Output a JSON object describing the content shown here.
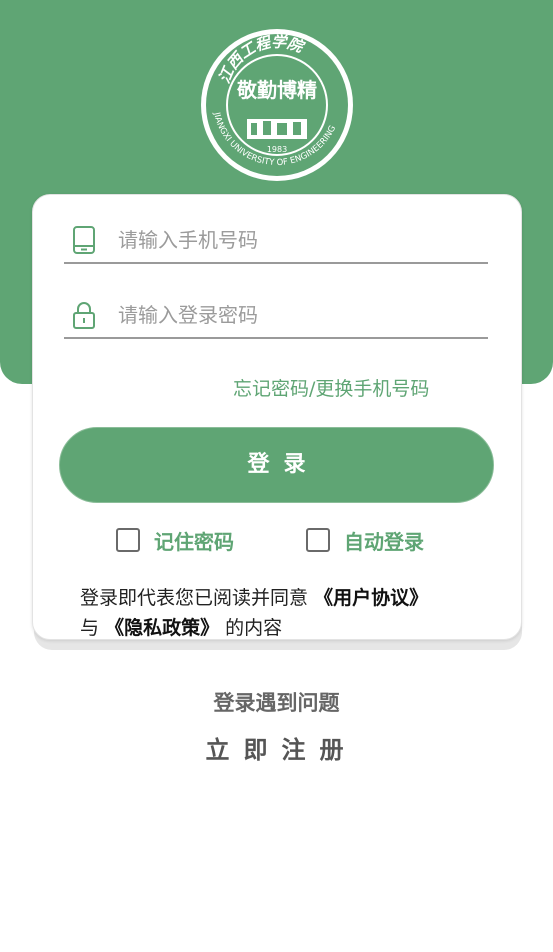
{
  "logo": {
    "icon": "university-seal-icon",
    "arc_top_text": "江西工程学院",
    "arc_bottom_text": "JIANGXI UNIVERSITY OF ENGINEERING",
    "motto": "敬勤博精",
    "year": "1983"
  },
  "form": {
    "phone": {
      "placeholder": "请输入手机号码",
      "value": "",
      "icon": "mobile-phone-icon"
    },
    "password": {
      "placeholder": "请输入登录密码",
      "value": "",
      "icon": "lock-icon"
    },
    "forgot_link": "忘记密码/更换手机号码",
    "login_button": "登录",
    "remember_password": {
      "label": "记住密码",
      "checked": false
    },
    "auto_login": {
      "label": "自动登录",
      "checked": false
    }
  },
  "agreement": {
    "prefix": "登录即代表您已阅读并同意",
    "user_agreement": "《用户协议》",
    "and": "与",
    "privacy_policy": "《隐私政策》",
    "suffix": "的内容"
  },
  "footer": {
    "problem_link": "登录遇到问题",
    "register_link": "立即注册"
  },
  "colors": {
    "primary": "#5fa574",
    "underline": "#9a9a9a",
    "text_muted": "#666666"
  }
}
